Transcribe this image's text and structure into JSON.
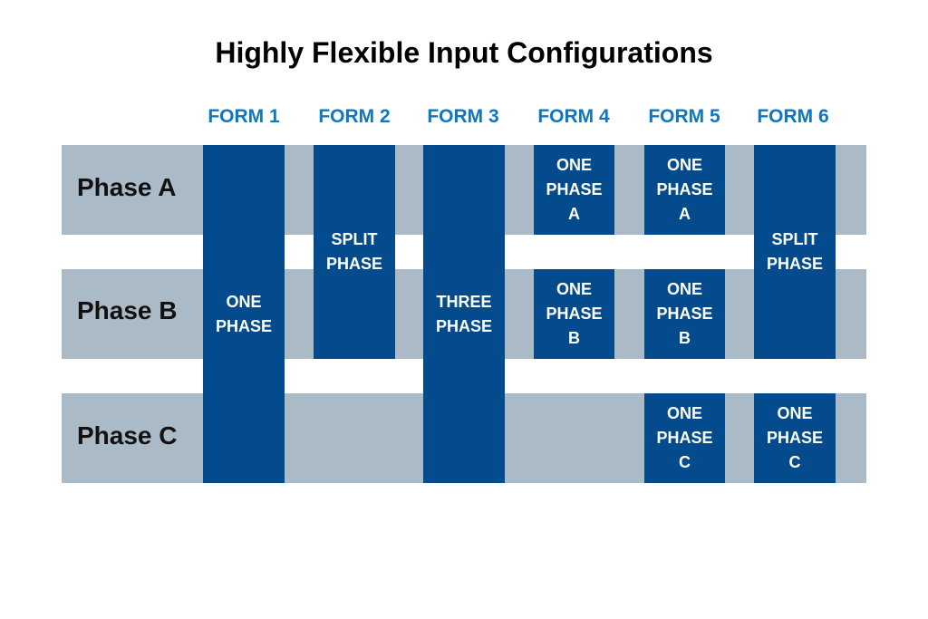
{
  "title": "Highly Flexible Input Configurations",
  "colors": {
    "form_label": "#0f76c0",
    "band": "#abbac7",
    "block": "#034b8c"
  },
  "forms": [
    "FORM 1",
    "FORM 2",
    "FORM 3",
    "FORM 4",
    "FORM 5",
    "FORM 6"
  ],
  "phases": [
    "Phase A",
    "Phase B",
    "Phase C"
  ],
  "blocks": {
    "form1": [
      "ONE",
      "PHASE"
    ],
    "form2": [
      "SPLIT",
      "PHASE"
    ],
    "form3": [
      "THREE",
      "PHASE"
    ],
    "form4a": [
      "ONE",
      "PHASE",
      "A"
    ],
    "form4b": [
      "ONE",
      "PHASE",
      "B"
    ],
    "form5a": [
      "ONE",
      "PHASE",
      "A"
    ],
    "form5b": [
      "ONE",
      "PHASE",
      "B"
    ],
    "form5c": [
      "ONE",
      "PHASE",
      "C"
    ],
    "form6ab": [
      "SPLIT",
      "PHASE"
    ],
    "form6c": [
      "ONE",
      "PHASE",
      "C"
    ]
  }
}
